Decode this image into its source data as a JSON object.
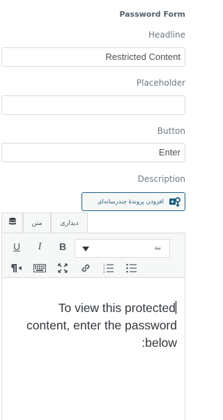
{
  "panel": {
    "section_title": "Password Form",
    "headline_label": "Headline",
    "headline_value": "Restricted Content",
    "placeholder_label": "Placeholder",
    "placeholder_value": "",
    "button_label": "Button",
    "button_value": "Enter",
    "description_label": "Description"
  },
  "editor": {
    "add_media_label": "افزودن پروندهٔ چندرسانه‌ای",
    "tabs": {
      "visual": "دیداری",
      "text": "متن"
    },
    "format_select_value": "بند",
    "content": "To view this protected content, enter the password :below",
    "icons": [
      "underline-icon",
      "italic-icon",
      "bold-icon",
      "paragraph-rtl-icon",
      "keyboard-icon",
      "fullscreen-icon",
      "link-icon",
      "ordered-list-icon",
      "bullet-list-icon",
      "database-icon",
      "media-icon"
    ]
  },
  "colors": {
    "accent": "#1e5f80",
    "border": "#d5dadf",
    "label": "#6d7882"
  }
}
